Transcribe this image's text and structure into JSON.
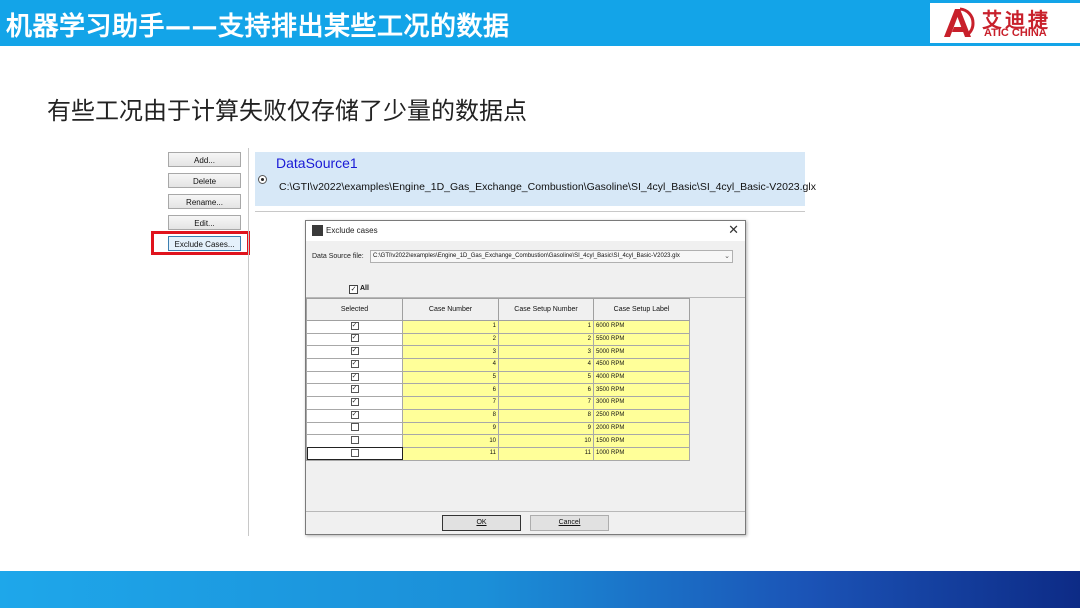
{
  "header": {
    "title": "机器学习助手——支持排出某些工况的数据",
    "logo_cn": "艾迪捷",
    "logo_en": "ATIC CHINA"
  },
  "subtitle": "有些工况由于计算失败仅存储了少量的数据点",
  "side_buttons": {
    "add": "Add...",
    "delete": "Delete",
    "rename": "Rename...",
    "edit": "Edit...",
    "exclude": "Exclude Cases..."
  },
  "datasource": {
    "name": "DataSource1",
    "path": "C:\\GTI\\v2022\\examples\\Engine_1D_Gas_Exchange_Combustion\\Gasoline\\SI_4cyl_Basic\\SI_4cyl_Basic-V2023.glx"
  },
  "dialog": {
    "title": "Exclude cases",
    "close": "✕",
    "file_label": "Data Source file:",
    "file_value": "C:\\GTI\\v2022\\examples\\Engine_1D_Gas_Exchange_Combustion\\Gasoline\\SI_4cyl_Basic\\SI_4cyl_Basic-V2023.glx",
    "all_label": "All",
    "columns": [
      "Selected",
      "Case Number",
      "Case Setup Number",
      "Case Setup Label"
    ],
    "rows": [
      {
        "checked": true,
        "case": "1",
        "setup": "1",
        "label": "6000 RPM"
      },
      {
        "checked": true,
        "case": "2",
        "setup": "2",
        "label": "5500 RPM"
      },
      {
        "checked": true,
        "case": "3",
        "setup": "3",
        "label": "5000 RPM"
      },
      {
        "checked": true,
        "case": "4",
        "setup": "4",
        "label": "4500 RPM"
      },
      {
        "checked": true,
        "case": "5",
        "setup": "5",
        "label": "4000 RPM"
      },
      {
        "checked": true,
        "case": "6",
        "setup": "6",
        "label": "3500 RPM"
      },
      {
        "checked": true,
        "case": "7",
        "setup": "7",
        "label": "3000 RPM"
      },
      {
        "checked": true,
        "case": "8",
        "setup": "8",
        "label": "2500 RPM"
      },
      {
        "checked": false,
        "case": "9",
        "setup": "9",
        "label": "2000 RPM"
      },
      {
        "checked": false,
        "case": "10",
        "setup": "10",
        "label": "1500 RPM"
      },
      {
        "checked": false,
        "case": "11",
        "setup": "11",
        "label": "1000 RPM"
      }
    ],
    "ok_label": "OK",
    "cancel_label": "Cancel"
  },
  "colors": {
    "header": "#13a4e8",
    "highlight": "#e0131d",
    "cell_yellow": "#ffff99",
    "datasource_bg": "#d7e8f7"
  }
}
